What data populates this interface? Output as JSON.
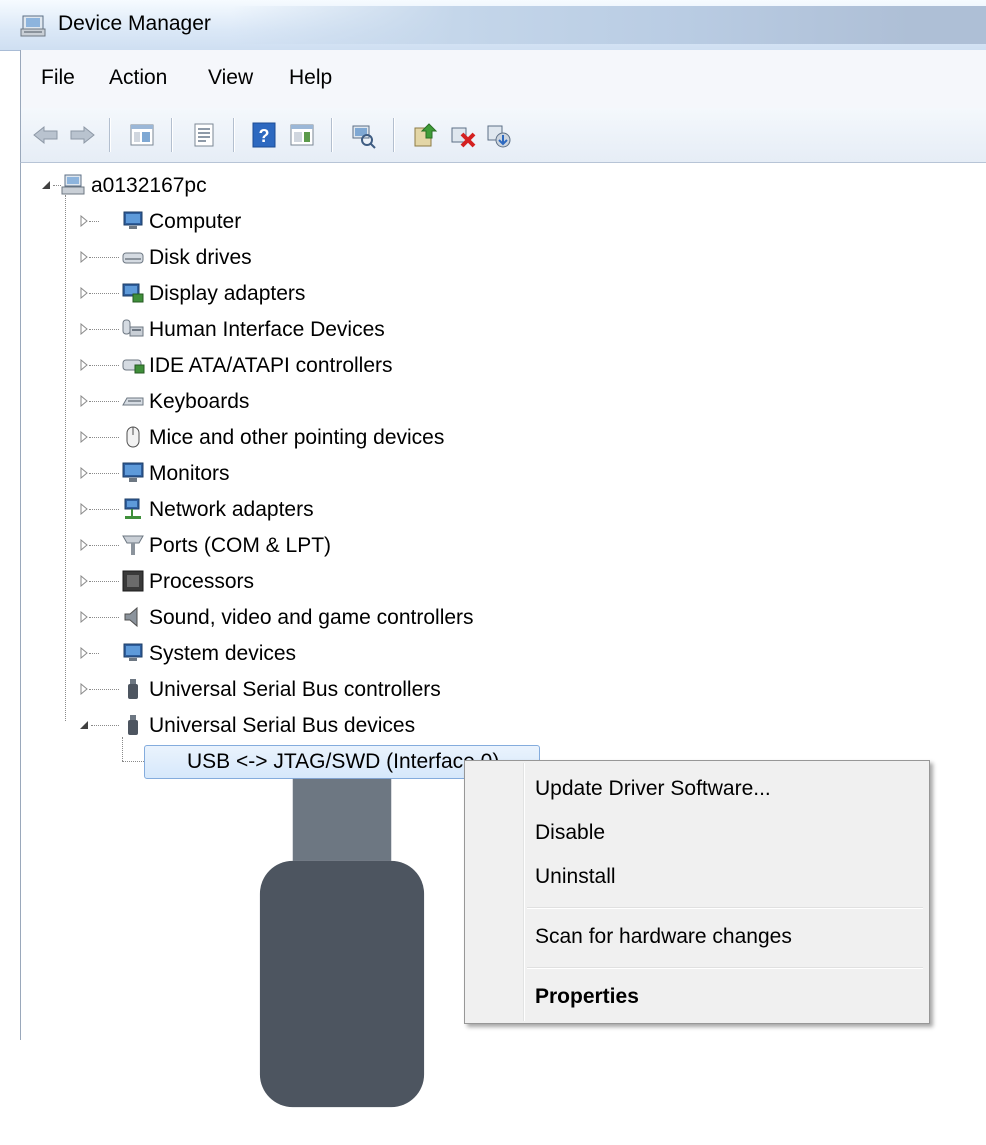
{
  "window": {
    "title": "Device Manager"
  },
  "menu": [
    "File",
    "Action",
    "View",
    "Help"
  ],
  "toolbar": {
    "buttons": [
      "back-icon",
      "forward-icon",
      "show-hide-console-tree-icon",
      "properties-icon",
      "help-icon",
      "show-action-pane-icon",
      "scan-hardware-icon",
      "update-driver-icon",
      "uninstall-icon",
      "disable-icon"
    ]
  },
  "tree": {
    "root": "a0132167pc",
    "categories": [
      "Computer",
      "Disk drives",
      "Display adapters",
      "Human Interface Devices",
      "IDE ATA/ATAPI controllers",
      "Keyboards",
      "Mice and other pointing devices",
      "Monitors",
      "Network adapters",
      "Ports (COM & LPT)",
      "Processors",
      "Sound, video and game controllers",
      "System devices",
      "Universal Serial Bus controllers",
      "Universal Serial Bus devices"
    ],
    "selected_device": "USB <-> JTAG/SWD (Interface 0)"
  },
  "context_menu": {
    "items": [
      "Update Driver Software...",
      "Disable",
      "Uninstall",
      "Scan for hardware changes",
      "Properties"
    ]
  }
}
